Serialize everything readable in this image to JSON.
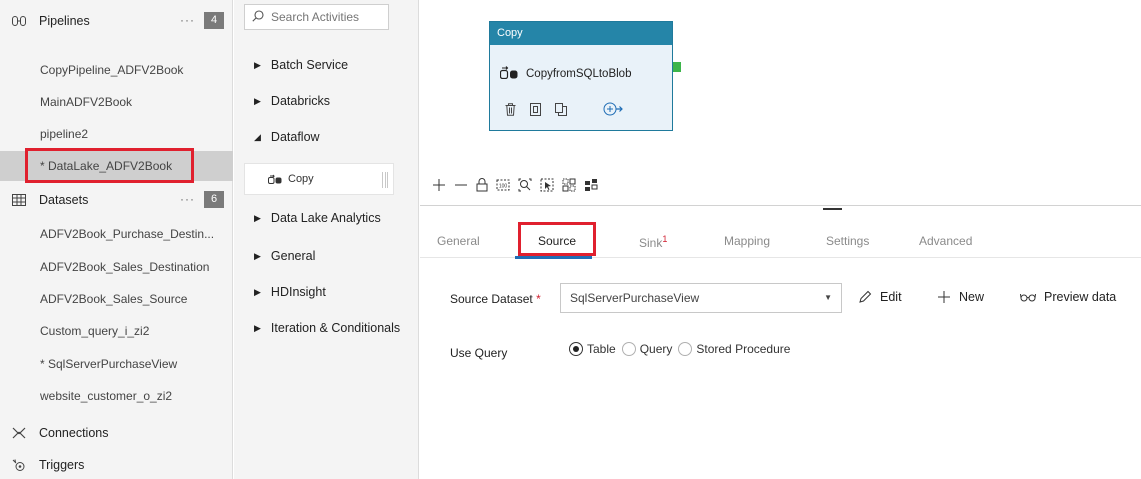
{
  "resources": {
    "pipelines": {
      "label": "Pipelines",
      "more": "···",
      "count": "4",
      "items": [
        "CopyPipeline_ADFV2Book",
        "MainADFV2Book",
        "pipeline2",
        "* DataLake_ADFV2Book"
      ]
    },
    "datasets": {
      "label": "Datasets",
      "more": "···",
      "count": "6",
      "items": [
        "ADFV2Book_Purchase_Destin...",
        "ADFV2Book_Sales_Destination",
        "ADFV2Book_Sales_Source",
        "Custom_query_i_zi2",
        "* SqlServerPurchaseView",
        "website_customer_o_zi2"
      ]
    },
    "connections": {
      "label": "Connections"
    },
    "triggers": {
      "label": "Triggers"
    }
  },
  "activities": {
    "search_placeholder": "Search Activities",
    "categories": [
      "Batch Service",
      "Databricks",
      "Dataflow",
      "Data Lake Analytics",
      "General",
      "HDInsight",
      "Iteration & Conditionals"
    ],
    "dataflow_item": "Copy"
  },
  "canvas": {
    "node": {
      "type": "Copy",
      "name": "CopyfromSQLtoBlob"
    }
  },
  "properties": {
    "tabs": [
      "General",
      "Source",
      "Sink",
      "Mapping",
      "Settings",
      "Advanced"
    ],
    "sink_badge": "1",
    "active_tab": "Source",
    "source_dataset_label": "Source Dataset",
    "required_mark": "*",
    "source_dataset_value": "SqlServerPurchaseView",
    "edit_label": "Edit",
    "new_label": "New",
    "preview_label": "Preview data",
    "use_query_label": "Use Query",
    "query_options": [
      "Table",
      "Query",
      "Stored Procedure"
    ],
    "selected_query_option": "Table"
  },
  "colors": {
    "accent_blue": "#1f6db5",
    "node_header": "#2585a8",
    "highlight_red": "#e0202e",
    "output_port_green": "#3cb54a"
  }
}
